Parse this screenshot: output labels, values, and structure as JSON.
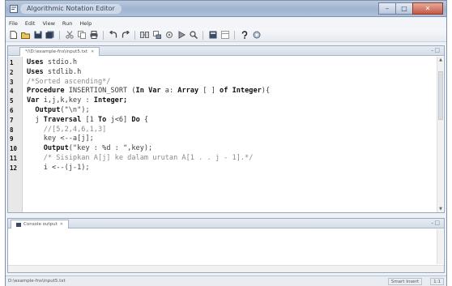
{
  "window": {
    "title": "Algorithmic Notation Editor",
    "controls": {
      "minimize": "–",
      "maximize": "□",
      "close": "✕"
    }
  },
  "menu": [
    "File",
    "Edit",
    "View",
    "Run",
    "Help"
  ],
  "toolbar": {
    "icons": [
      "new-file-icon",
      "open-folder-icon",
      "save-icon",
      "save-all-icon",
      "cut-icon",
      "copy-icon",
      "print-icon",
      "undo-icon",
      "redo-icon",
      "find-icon",
      "replace-icon",
      "compile-icon",
      "run-icon",
      "search-icon",
      "help-icon",
      "settings-icon"
    ]
  },
  "editor": {
    "tab_label": "*/\\D:\\example-fns\\input5.txt",
    "tab_close": "✕",
    "lines": [
      {
        "num": "1",
        "tokens": [
          {
            "t": "Uses ",
            "c": "kw"
          },
          {
            "t": "stdio.h",
            "c": ""
          }
        ]
      },
      {
        "num": "2",
        "tokens": [
          {
            "t": "Uses ",
            "c": "kw"
          },
          {
            "t": "stdlib.h",
            "c": ""
          }
        ]
      },
      {
        "num": "3",
        "tokens": [
          {
            "t": "/*Sorted ascending*/",
            "c": "cm"
          }
        ]
      },
      {
        "num": "4",
        "tokens": [
          {
            "t": "Procedure ",
            "c": "kw"
          },
          {
            "t": "INSERTION_SORT (",
            "c": ""
          },
          {
            "t": "In Var ",
            "c": "kw"
          },
          {
            "t": "a: ",
            "c": ""
          },
          {
            "t": "Array ",
            "c": "kw"
          },
          {
            "t": "[ ] ",
            "c": ""
          },
          {
            "t": "of Integer",
            "c": "kw"
          },
          {
            "t": "){",
            "c": ""
          }
        ]
      },
      {
        "num": "5",
        "tokens": [
          {
            "t": "Var ",
            "c": "kw"
          },
          {
            "t": "i,j,k,key : ",
            "c": ""
          },
          {
            "t": "Integer;",
            "c": "kw"
          }
        ]
      },
      {
        "num": "6",
        "tokens": [
          {
            "t": "  Output",
            "c": "kw"
          },
          {
            "t": "(\"\\n\");",
            "c": ""
          }
        ]
      },
      {
        "num": "7",
        "tokens": [
          {
            "t": "  j ",
            "c": ""
          },
          {
            "t": "Traversal ",
            "c": "kw"
          },
          {
            "t": "[1 ",
            "c": ""
          },
          {
            "t": "To ",
            "c": "kw"
          },
          {
            "t": "j<6] ",
            "c": ""
          },
          {
            "t": "Do ",
            "c": "kw"
          },
          {
            "t": "{",
            "c": ""
          }
        ]
      },
      {
        "num": "8",
        "tokens": [
          {
            "t": "    //[5,2,4,6,1,3]",
            "c": "cm"
          }
        ]
      },
      {
        "num": "9",
        "tokens": [
          {
            "t": "    key <--a[j];",
            "c": ""
          }
        ]
      },
      {
        "num": "10",
        "tokens": [
          {
            "t": "    ",
            "c": ""
          },
          {
            "t": "Output",
            "c": "kw"
          },
          {
            "t": "(\"key : %d : \",key);",
            "c": ""
          }
        ]
      },
      {
        "num": "11",
        "tokens": [
          {
            "t": "    /* Sisipkan A[j] ke dalam urutan A[1 . . j - 1].*/",
            "c": "cm"
          }
        ]
      },
      {
        "num": "12",
        "tokens": [
          {
            "t": "    i <--(j-1);",
            "c": ""
          }
        ]
      }
    ]
  },
  "console": {
    "tab_label": "Console output",
    "tab_close": "✕"
  },
  "status": {
    "path": "D:\\example-fns\\input5.txt",
    "mode": "Smart Insert",
    "position": "1:1"
  },
  "colors": {
    "titlebar": "#a9bcd6",
    "keyword": "#111111",
    "comment": "#8a8a8a",
    "gutter": "#e8e8e8"
  }
}
